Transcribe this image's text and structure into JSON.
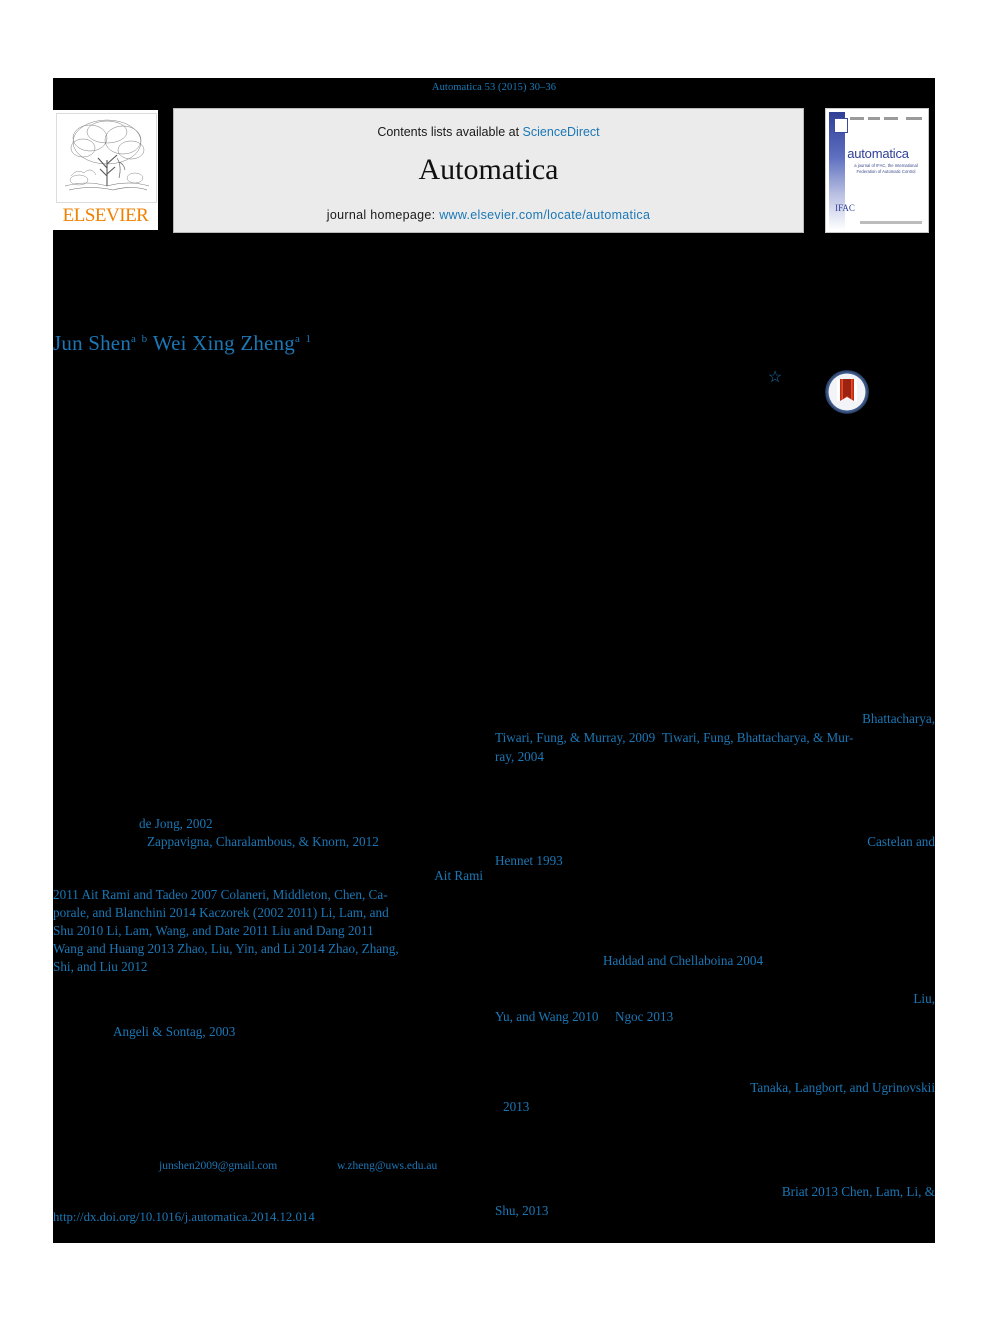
{
  "running_head": "Automatica 53 (2015) 30–36",
  "masthead": {
    "elsevier_wordmark": "ELSEVIER",
    "contents_prefix": "Contents lists available at ",
    "contents_link": "ScienceDirect",
    "journal_title": "Automatica",
    "homepage_prefix": "journal homepage: ",
    "homepage_url": "www.elsevier.com/locate/automatica",
    "cover": {
      "name": "automatica",
      "subtitle": "a journal of IFAC, the International Federation of Automatic Control",
      "society": "IFAC"
    }
  },
  "authors": {
    "first": "Jun Shen",
    "first_affil": "a",
    "first_affil2": "b",
    "second": "Wei Xing Zheng",
    "second_affil": "a",
    "second_note": "1"
  },
  "marks": {
    "star": "☆",
    "crossmark": "crossmark-badge"
  },
  "citations": {
    "bhattacharya": "Bhattacharya,",
    "tiwari_fung_murray": "Tiwari, Fung, & Murray, 2009",
    "tiwari_fung_bhatt": "Tiwari, Fung, Bhattacharya, & Mur-",
    "ray_2004": "ray, 2004",
    "de_jong": "de Jong, 2002",
    "zappavigna": "Zappavigna, Charalambous, & Knorn, 2012",
    "castelan_and": "Castelan and",
    "hennet": "Hennet  1993",
    "ait_rami": "Ait Rami",
    "positive_block_line1": " 2011  Ait Rami and Tadeo  2007   Colaneri, Middleton, Chen, Ca-",
    "positive_block_line2": "porale, and Blanchini  2014   Kaczorek (2002  2011) Li, Lam, and",
    "positive_block_line3": "Shu  2010  Li, Lam, Wang, and Date  2011   Liu and Dang  2011",
    "positive_block_line4": "Wang and Huang  2013   Zhao, Liu, Yin, and Li  2014   Zhao, Zhang,",
    "positive_block_line5": "Shi, and Liu  2012",
    "haddad": "Haddad  and  Chellaboina   2004",
    "liu_partial": "Liu,",
    "yu_and_wang": "Yu, and Wang  2010",
    "ngoc": "Ngoc  2013",
    "angeli_sontag": "Angeli & Sontag, 2003",
    "tanaka": "Tanaka, Langbort, and Ugrinovskii",
    "tanaka_year": "2013",
    "briat": "Briat   2013   Chen,  Lam,  Li,  &",
    "chen_shu": "Shu, 2013"
  },
  "footnotes": {
    "email_first": "junshen2009@gmail.com",
    "email_second": "w.zheng@uws.edu.au",
    "doi": "http://dx.doi.org/10.1016/j.automatica.2014.12.014"
  },
  "colors": {
    "link": "#1b77b5",
    "elsevier_orange": "#f08000",
    "cover_blue": "#2f3f97",
    "page_background": "#000000"
  }
}
